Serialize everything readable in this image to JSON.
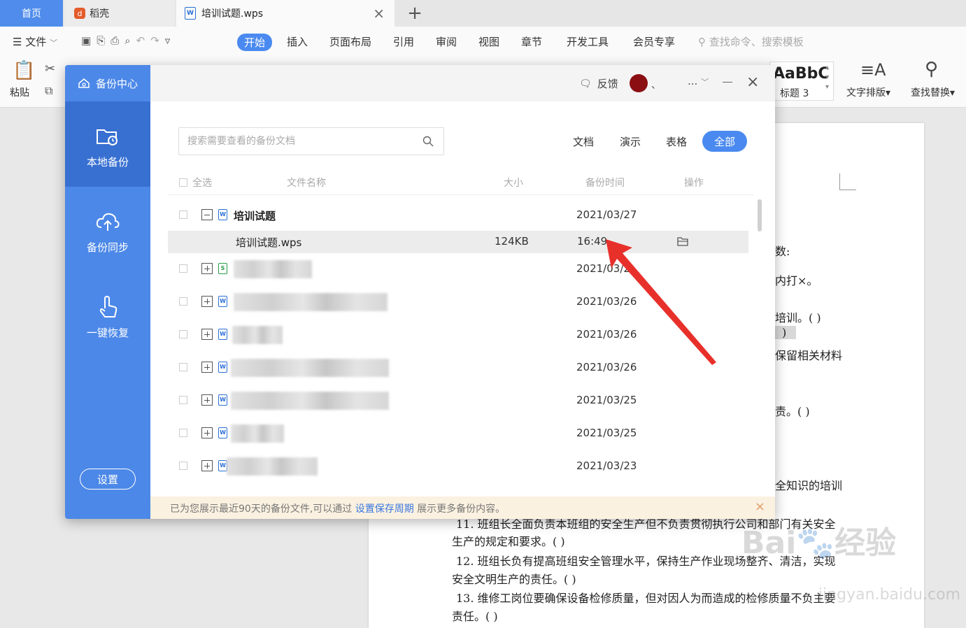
{
  "tabs": {
    "home": "首页",
    "daoke": "稻壳",
    "doc": "培训试题.wps"
  },
  "menu": {
    "file": "文件",
    "items": [
      "开始",
      "插入",
      "页面布局",
      "引用",
      "审阅",
      "视图",
      "章节",
      "开发工具",
      "会员专享"
    ],
    "search_placeholder": "查找命令、搜索模板"
  },
  "ribbon": {
    "paste": "粘贴",
    "style_preview": "AaBbC",
    "style_name": "标题 3",
    "text_layout": "文字排版",
    "find_replace": "查找替换"
  },
  "dialog": {
    "title": "备份中心",
    "sidebar": [
      {
        "label": "本地备份",
        "icon": "folder-clock-icon",
        "active": true
      },
      {
        "label": "备份同步",
        "icon": "cloud-upload-icon",
        "active": false
      },
      {
        "label": "一键恢复",
        "icon": "hand-tap-icon",
        "active": false
      }
    ],
    "settings": "设置",
    "feedback": "反馈",
    "more": "...",
    "search_placeholder": "搜索需要查看的备份文档",
    "filters": [
      "文档",
      "演示",
      "表格",
      "全部"
    ],
    "active_filter": "全部",
    "columns": {
      "select_all": "全选",
      "name": "文件名称",
      "size": "大小",
      "time": "备份时间",
      "action": "操作"
    },
    "rows": [
      {
        "name": "培训试题",
        "date": "2021/03/27",
        "expanded": true
      },
      {
        "name": "培训试题.wps",
        "size": "124KB",
        "time": "16:49",
        "child": true
      },
      {
        "name": "",
        "date": "2021/03/2"
      },
      {
        "name": "",
        "date": "2021/03/26"
      },
      {
        "name": "",
        "date": "2021/03/26"
      },
      {
        "name": "",
        "date": "2021/03/26"
      },
      {
        "name": "",
        "date": "2021/03/25"
      },
      {
        "name": "",
        "date": "2021/03/25"
      },
      {
        "name": "",
        "date": "2021/03/23"
      }
    ],
    "notice": {
      "before": "已为您展示最近90天的备份文件,可以通过 ",
      "link": "设置保存周期",
      "after": " 展示更多备份内容。"
    }
  },
  "document": {
    "lines": [
      "数:",
      "内打×。",
      "培训。(  )",
      ")",
      "保留相关材料",
      "责。(  )",
      "全知识的培训",
      "11. 班组长全面负责本班组的安全生产但不负责贯彻执行公司和部门有关安全",
      "生产的规定和要求。(  )",
      "12. 班组长负有提高班组安全管理水平，保持生产作业现场整齐、清洁，实现",
      "安全文明生产的责任。(  )",
      "13. 维修工岗位要确保设备检修质量，但对因人为而造成的检修质量不负主要",
      "责任。(  )"
    ]
  },
  "colors": {
    "accent": "#4a8af0",
    "sidebar": "#4c88e8",
    "sidebar_active": "#3870d2",
    "arrow": "#e8302b",
    "notice_bg": "#fbf1e0"
  }
}
